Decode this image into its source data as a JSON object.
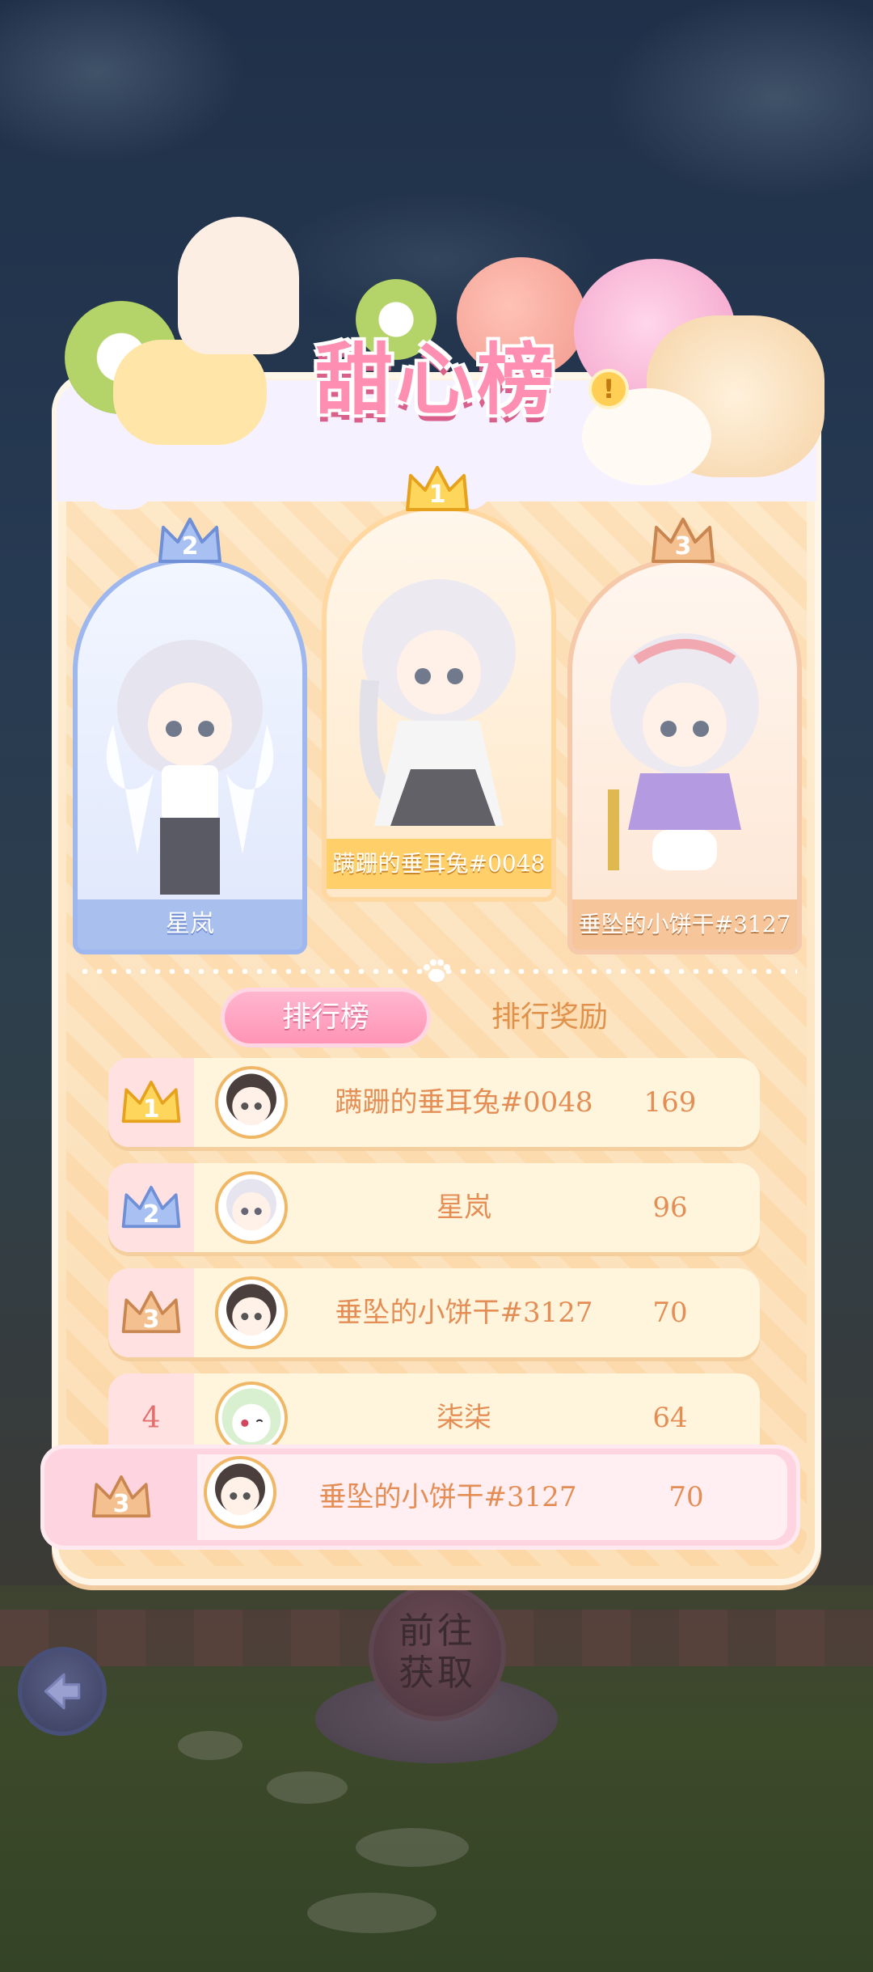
{
  "title": "甜心榜",
  "back_button": {
    "icon": "arrow-left-icon"
  },
  "goto_button": {
    "label": "前往\n获取"
  },
  "podium": [
    {
      "rank": "2",
      "name": "星岚",
      "color": "#9fb7ef"
    },
    {
      "rank": "1",
      "name": "蹒跚的垂耳兔#0048",
      "color": "#ffc94d"
    },
    {
      "rank": "3",
      "name": "垂坠的小饼干#3127",
      "color": "#eba56f"
    }
  ],
  "tabs": [
    {
      "label": "排行榜",
      "active": true
    },
    {
      "label": "排行奖励",
      "active": false
    }
  ],
  "rankings": [
    {
      "rank": "1",
      "name": "蹒跚的垂耳兔#0048",
      "score": "169",
      "badge": "gold"
    },
    {
      "rank": "2",
      "name": "星岚",
      "score": "96",
      "badge": "silver"
    },
    {
      "rank": "3",
      "name": "垂坠的小饼干#3127",
      "score": "70",
      "badge": "bronze"
    },
    {
      "rank": "4",
      "name": "柒柒",
      "score": "64",
      "badge": "none"
    }
  ],
  "self": {
    "rank": "3",
    "name": "垂坠的小饼干#3127",
    "score": "70",
    "badge": "bronze"
  },
  "colors": {
    "accent_pink": "#ff94b6",
    "text_orange": "#e48e56",
    "gold": "#ffc94d",
    "silver": "#9fb7ef",
    "bronze": "#eba56f"
  }
}
